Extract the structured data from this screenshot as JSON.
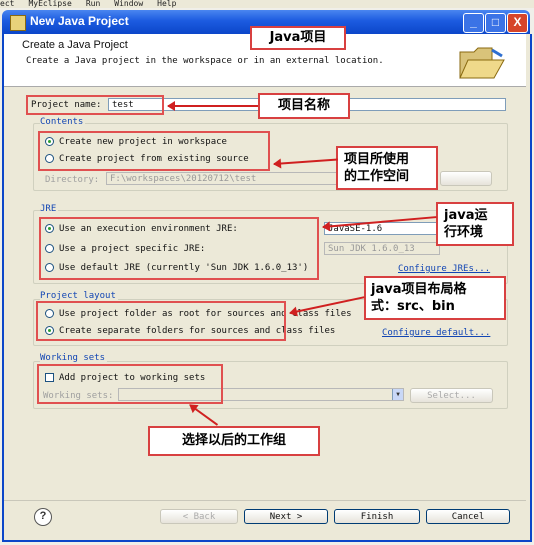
{
  "menubar": {
    "items": [
      "ect",
      "MyEclipse",
      "Run",
      "Window",
      "Help"
    ]
  },
  "window": {
    "title": "New Java Project",
    "min": "_",
    "max": "□",
    "close": "X"
  },
  "header": {
    "title": "Create a Java Project",
    "description": "Create a Java project in the workspace or in an external location."
  },
  "project": {
    "label": "Project name:",
    "value": "test"
  },
  "contents": {
    "title": "Contents",
    "option_new": "Create new project in workspace",
    "option_existing": "Create project from existing source",
    "directory_label": "Directory:",
    "directory_value": "F:\\workspaces\\20120712\\test"
  },
  "jre": {
    "title": "JRE",
    "option_env": "Use an execution environment JRE:",
    "env_value": "JavaSE-1.6",
    "option_specific": "Use a project specific JRE:",
    "specific_value": "Sun JDK 1.6.0_13",
    "option_default": "Use default JRE (currently 'Sun JDK 1.6.0_13')",
    "configure_link": "Configure JREs..."
  },
  "layout": {
    "title": "Project layout",
    "option_root": "Use project folder as root for sources and class files",
    "option_separate": "Create separate folders for sources and class files",
    "configure_link": "Configure default..."
  },
  "working_sets": {
    "title": "Working sets",
    "add_label": "Add project to working sets",
    "sets_label": "Working sets:",
    "select_button": "Select..."
  },
  "buttons": {
    "help": "?",
    "back": "< Back",
    "next": "Next >",
    "finish": "Finish",
    "cancel": "Cancel"
  },
  "annotations": {
    "java_project": "Java项目",
    "project_name": "项目名称",
    "workspace_line1": "项目所使用",
    "workspace_line2": "的工作空间",
    "jre_line1": "java运",
    "jre_line2": "行环境",
    "layout_line1": "java项目布局格",
    "layout_line2": "式：src、bin",
    "working_group": "选择以后的工作组"
  }
}
